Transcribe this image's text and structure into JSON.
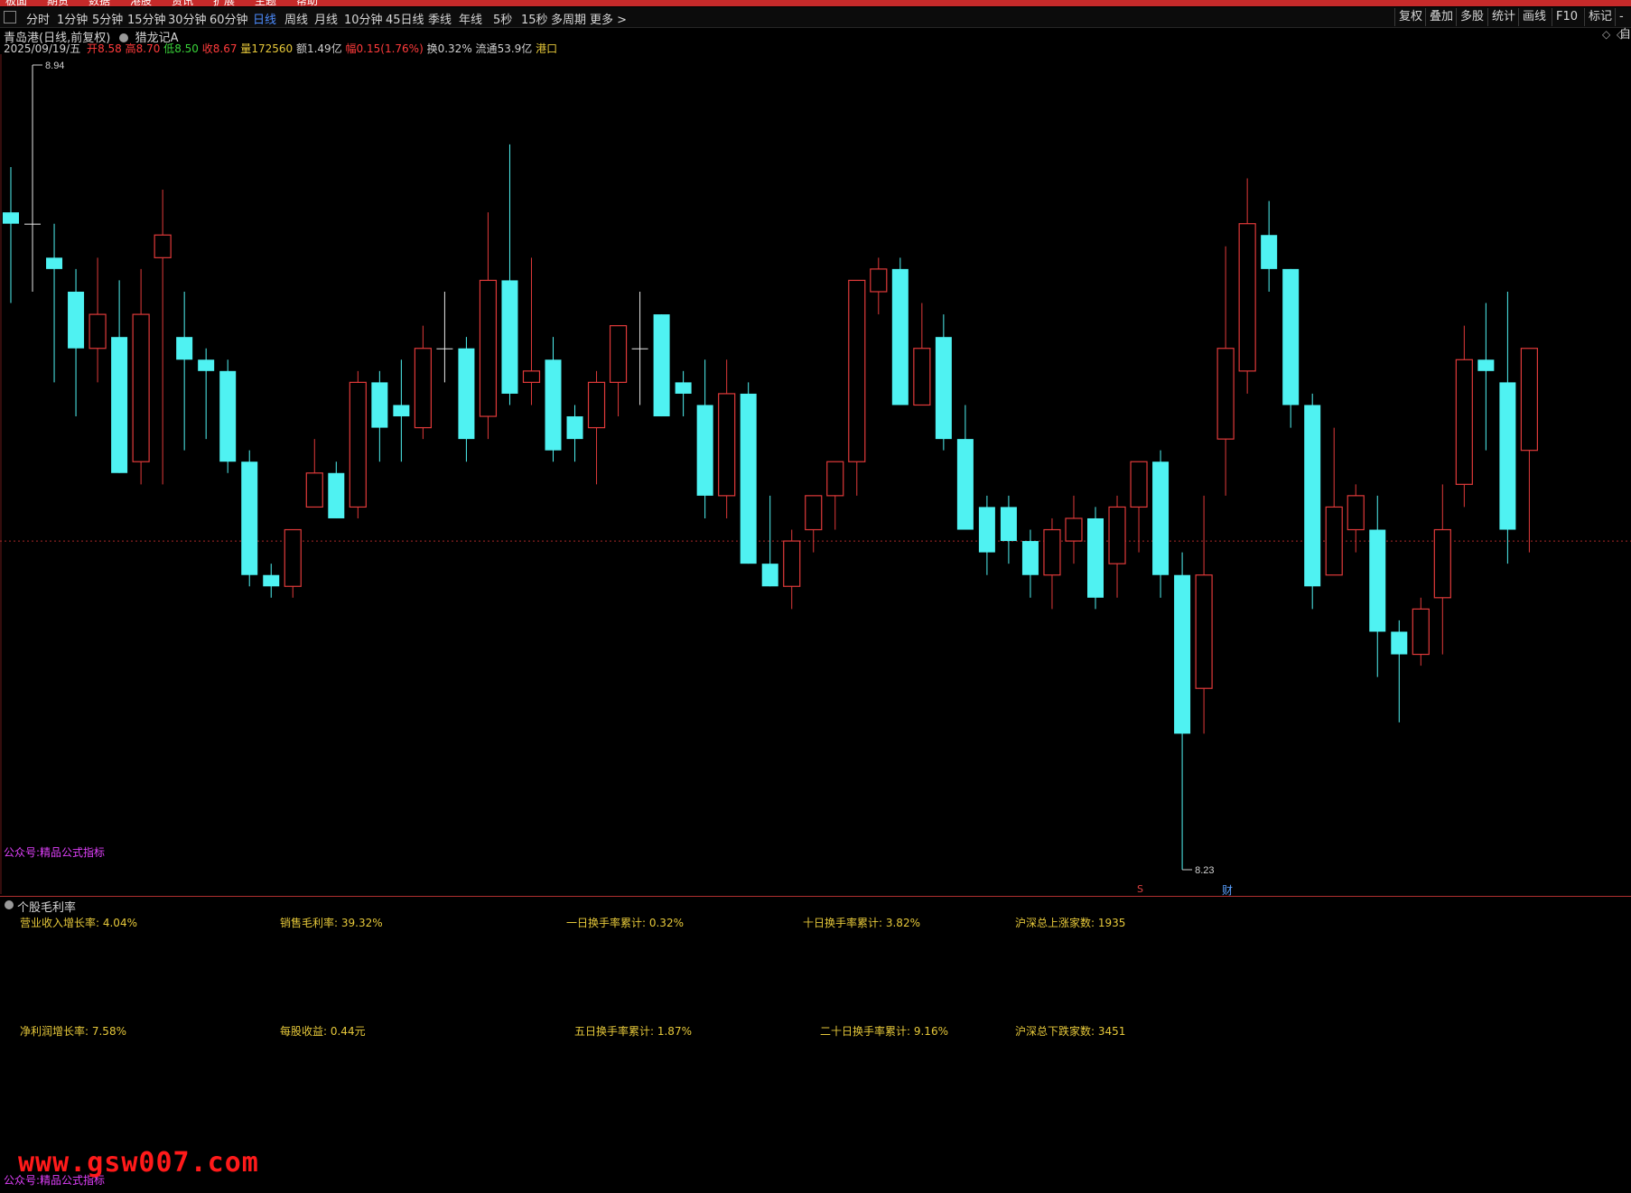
{
  "toolbar": {
    "menu": [
      "板面",
      "期货",
      "数据",
      "港股",
      "资讯",
      "扩展",
      "主题",
      "帮助"
    ],
    "periods": [
      "分时",
      "1分钟",
      "5分钟",
      "15分钟",
      "30分钟",
      "60分钟",
      "日线",
      "周线",
      "月线",
      "10分钟",
      "45日线",
      "季线",
      "年线",
      "5秒",
      "15秒",
      "多周期",
      "更多 >"
    ],
    "active_period": "日线",
    "right_buttons": [
      "复权",
      "叠加",
      "多股",
      "统计",
      "画线",
      "F10",
      "标记",
      "-自"
    ]
  },
  "stock": {
    "title": "青岛港(日线,前复权)",
    "indicator": "猎龙记A",
    "date": "2025/09/19/五",
    "open_label": "开",
    "open": "8.58",
    "high_label": "高",
    "high": "8.70",
    "low_label": "低",
    "low": "8.50",
    "close_label": "收",
    "close": "8.67",
    "volume_label": "量",
    "volume": "172560",
    "amount_label": "额",
    "amount": "1.49亿",
    "change_label": "幅",
    "change": "0.15(1.76%)",
    "turnover_label": "换",
    "turnover": "0.32%",
    "float_label": "流通",
    "float": "53.9亿",
    "tag": "港口"
  },
  "chart_markers": {
    "max_label": "8.94",
    "min_label": "8.23",
    "event_s": "S",
    "event_cai": "财",
    "source_tag": "公众号:精品公式指标"
  },
  "chart_data": {
    "type": "candlestick",
    "y_range": [
      8.23,
      8.94
    ],
    "reference_price": 8.52,
    "candles": [
      {
        "o": 8.81,
        "h": 8.85,
        "l": 8.73,
        "c": 8.8
      },
      {
        "o": 8.8,
        "h": 8.94,
        "l": 8.74,
        "c": 8.8
      },
      {
        "o": 8.77,
        "h": 8.8,
        "l": 8.66,
        "c": 8.76
      },
      {
        "o": 8.74,
        "h": 8.76,
        "l": 8.63,
        "c": 8.69
      },
      {
        "o": 8.69,
        "h": 8.77,
        "l": 8.66,
        "c": 8.72
      },
      {
        "o": 8.7,
        "h": 8.75,
        "l": 8.6,
        "c": 8.58
      },
      {
        "o": 8.59,
        "h": 8.76,
        "l": 8.57,
        "c": 8.72
      },
      {
        "o": 8.77,
        "h": 8.83,
        "l": 8.57,
        "c": 8.79
      },
      {
        "o": 8.7,
        "h": 8.74,
        "l": 8.6,
        "c": 8.68
      },
      {
        "o": 8.68,
        "h": 8.69,
        "l": 8.61,
        "c": 8.67
      },
      {
        "o": 8.67,
        "h": 8.68,
        "l": 8.58,
        "c": 8.59
      },
      {
        "o": 8.59,
        "h": 8.6,
        "l": 8.48,
        "c": 8.49
      },
      {
        "o": 8.49,
        "h": 8.5,
        "l": 8.47,
        "c": 8.48
      },
      {
        "o": 8.48,
        "h": 8.53,
        "l": 8.47,
        "c": 8.53
      },
      {
        "o": 8.55,
        "h": 8.61,
        "l": 8.55,
        "c": 8.58
      },
      {
        "o": 8.58,
        "h": 8.59,
        "l": 8.54,
        "c": 8.54
      },
      {
        "o": 8.55,
        "h": 8.67,
        "l": 8.54,
        "c": 8.66
      },
      {
        "o": 8.66,
        "h": 8.67,
        "l": 8.59,
        "c": 8.62
      },
      {
        "o": 8.64,
        "h": 8.68,
        "l": 8.59,
        "c": 8.63
      },
      {
        "o": 8.62,
        "h": 8.71,
        "l": 8.61,
        "c": 8.69
      },
      {
        "o": 8.69,
        "h": 8.74,
        "l": 8.66,
        "c": 8.69
      },
      {
        "o": 8.69,
        "h": 8.7,
        "l": 8.59,
        "c": 8.61
      },
      {
        "o": 8.63,
        "h": 8.81,
        "l": 8.61,
        "c": 8.75
      },
      {
        "o": 8.75,
        "h": 8.87,
        "l": 8.64,
        "c": 8.65
      },
      {
        "o": 8.66,
        "h": 8.77,
        "l": 8.64,
        "c": 8.67
      },
      {
        "o": 8.68,
        "h": 8.7,
        "l": 8.59,
        "c": 8.6
      },
      {
        "o": 8.63,
        "h": 8.64,
        "l": 8.59,
        "c": 8.61
      },
      {
        "o": 8.62,
        "h": 8.67,
        "l": 8.57,
        "c": 8.66
      },
      {
        "o": 8.66,
        "h": 8.71,
        "l": 8.63,
        "c": 8.71
      },
      {
        "o": 8.69,
        "h": 8.74,
        "l": 8.64,
        "c": 8.69
      },
      {
        "o": 8.72,
        "h": 8.7,
        "l": 8.63,
        "c": 8.63
      },
      {
        "o": 8.66,
        "h": 8.67,
        "l": 8.63,
        "c": 8.65
      },
      {
        "o": 8.64,
        "h": 8.68,
        "l": 8.54,
        "c": 8.56
      },
      {
        "o": 8.56,
        "h": 8.68,
        "l": 8.54,
        "c": 8.65
      },
      {
        "o": 8.65,
        "h": 8.66,
        "l": 8.5,
        "c": 8.5
      },
      {
        "o": 8.5,
        "h": 8.56,
        "l": 8.48,
        "c": 8.48
      },
      {
        "o": 8.48,
        "h": 8.53,
        "l": 8.46,
        "c": 8.52
      },
      {
        "o": 8.53,
        "h": 8.56,
        "l": 8.51,
        "c": 8.56
      },
      {
        "o": 8.56,
        "h": 8.59,
        "l": 8.53,
        "c": 8.59
      },
      {
        "o": 8.59,
        "h": 8.73,
        "l": 8.56,
        "c": 8.75
      },
      {
        "o": 8.74,
        "h": 8.77,
        "l": 8.72,
        "c": 8.76
      },
      {
        "o": 8.76,
        "h": 8.77,
        "l": 8.64,
        "c": 8.64
      },
      {
        "o": 8.64,
        "h": 8.73,
        "l": 8.64,
        "c": 8.69
      },
      {
        "o": 8.7,
        "h": 8.72,
        "l": 8.6,
        "c": 8.61
      },
      {
        "o": 8.61,
        "h": 8.64,
        "l": 8.53,
        "c": 8.53
      },
      {
        "o": 8.55,
        "h": 8.56,
        "l": 8.49,
        "c": 8.51
      },
      {
        "o": 8.55,
        "h": 8.56,
        "l": 8.5,
        "c": 8.52
      },
      {
        "o": 8.52,
        "h": 8.53,
        "l": 8.47,
        "c": 8.49
      },
      {
        "o": 8.49,
        "h": 8.54,
        "l": 8.46,
        "c": 8.53
      },
      {
        "o": 8.52,
        "h": 8.56,
        "l": 8.5,
        "c": 8.54
      },
      {
        "o": 8.54,
        "h": 8.55,
        "l": 8.46,
        "c": 8.47
      },
      {
        "o": 8.5,
        "h": 8.56,
        "l": 8.47,
        "c": 8.55
      },
      {
        "o": 8.55,
        "h": 8.59,
        "l": 8.51,
        "c": 8.59
      },
      {
        "o": 8.59,
        "h": 8.6,
        "l": 8.47,
        "c": 8.49
      },
      {
        "o": 8.49,
        "h": 8.51,
        "l": 8.23,
        "c": 8.35
      },
      {
        "o": 8.39,
        "h": 8.56,
        "l": 8.35,
        "c": 8.49
      },
      {
        "o": 8.61,
        "h": 8.78,
        "l": 8.56,
        "c": 8.69
      },
      {
        "o": 8.67,
        "h": 8.84,
        "l": 8.65,
        "c": 8.8
      },
      {
        "o": 8.79,
        "h": 8.82,
        "l": 8.74,
        "c": 8.76
      },
      {
        "o": 8.76,
        "h": 8.75,
        "l": 8.62,
        "c": 8.64
      },
      {
        "o": 8.64,
        "h": 8.65,
        "l": 8.46,
        "c": 8.48
      },
      {
        "o": 8.49,
        "h": 8.62,
        "l": 8.49,
        "c": 8.55
      },
      {
        "o": 8.53,
        "h": 8.57,
        "l": 8.51,
        "c": 8.56
      },
      {
        "o": 8.53,
        "h": 8.56,
        "l": 8.4,
        "c": 8.44
      },
      {
        "o": 8.44,
        "h": 8.45,
        "l": 8.36,
        "c": 8.42
      },
      {
        "o": 8.42,
        "h": 8.47,
        "l": 8.41,
        "c": 8.46
      },
      {
        "o": 8.47,
        "h": 8.57,
        "l": 8.42,
        "c": 8.53
      },
      {
        "o": 8.57,
        "h": 8.71,
        "l": 8.55,
        "c": 8.68
      },
      {
        "o": 8.68,
        "h": 8.73,
        "l": 8.6,
        "c": 8.67
      },
      {
        "o": 8.66,
        "h": 8.74,
        "l": 8.5,
        "c": 8.53
      },
      {
        "o": 8.6,
        "h": 8.67,
        "l": 8.51,
        "c": 8.69
      }
    ],
    "top_dots": [
      10,
      11,
      15,
      31,
      35,
      36,
      45,
      46,
      47,
      48,
      55,
      56,
      57,
      59,
      61
    ]
  },
  "sub_panel": {
    "title": "个股毛利率",
    "stats": [
      {
        "label": "营业收入增长率:",
        "value": "4.04%"
      },
      {
        "label": "销售毛利率:",
        "value": "39.32%"
      },
      {
        "label": "一日换手率累计:",
        "value": "0.32%"
      },
      {
        "label": "十日换手率累计:",
        "value": "3.82%"
      },
      {
        "label": "沪深总上涨家数:",
        "value": "1935"
      },
      {
        "label": "净利润增长率:",
        "value": "7.58%"
      },
      {
        "label": "每股收益:",
        "value": "0.44元"
      },
      {
        "label": "五日换手率累计:",
        "value": "1.87%"
      },
      {
        "label": "二十日换手率累计:",
        "value": "9.16%"
      },
      {
        "label": "沪深总下跌家数:",
        "value": "3451"
      }
    ],
    "source_tag": "公众号:精品公式指标",
    "watermark": "www.gsw007.com"
  },
  "colors": {
    "up": "#e03a3a",
    "down": "#4ff2f2",
    "doji": "#e8e8e8",
    "dot": "#d63cd6",
    "stat_text": "#e6c83a",
    "menubar": "#c62a2a",
    "active_tab": "#4d8cff"
  }
}
